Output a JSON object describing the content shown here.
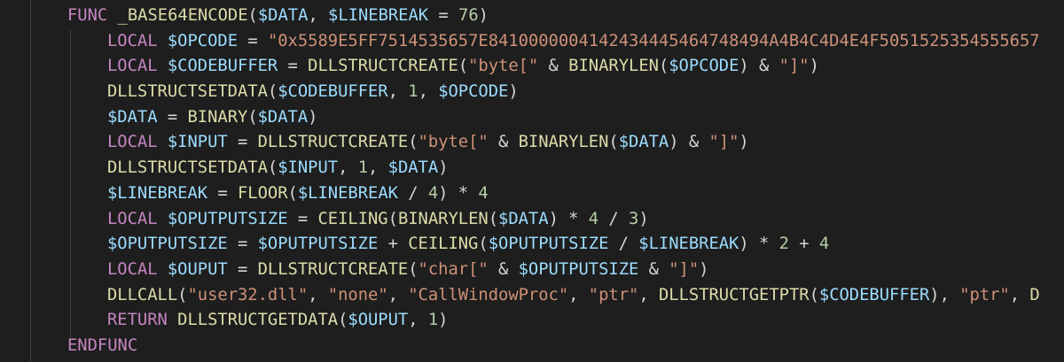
{
  "editor": {
    "colors": {
      "background": "#1e1e1e",
      "keyword": "#c586c0",
      "function": "#dcdcaa",
      "variable": "#9cdcfe",
      "string": "#ce9178",
      "number": "#b5cea8",
      "operator": "#d4d4d4"
    },
    "lines": [
      {
        "indent": 0,
        "tokens": [
          {
            "t": "FUNC",
            "c": "kw"
          },
          {
            "t": " ",
            "c": "op"
          },
          {
            "t": "_BASE64ENCODE",
            "c": "plain"
          },
          {
            "t": "(",
            "c": "op"
          },
          {
            "t": "$DATA",
            "c": "var"
          },
          {
            "t": ", ",
            "c": "op"
          },
          {
            "t": "$LINEBREAK",
            "c": "var"
          },
          {
            "t": " = ",
            "c": "op"
          },
          {
            "t": "76",
            "c": "num"
          },
          {
            "t": ")",
            "c": "op"
          }
        ]
      },
      {
        "indent": 1,
        "tokens": [
          {
            "t": "LOCAL",
            "c": "kw"
          },
          {
            "t": " ",
            "c": "op"
          },
          {
            "t": "$OPCODE",
            "c": "var"
          },
          {
            "t": " = ",
            "c": "op"
          },
          {
            "t": "\"0x5589E5FF7514535657E84100000041424344454647484​94A4B4C4D4E4F5051525354555657",
            "c": "str"
          }
        ]
      },
      {
        "indent": 1,
        "tokens": [
          {
            "t": "LOCAL",
            "c": "kw"
          },
          {
            "t": " ",
            "c": "op"
          },
          {
            "t": "$CODEBUFFER",
            "c": "var"
          },
          {
            "t": " = ",
            "c": "op"
          },
          {
            "t": "DLLSTRUCTCREATE",
            "c": "fn"
          },
          {
            "t": "(",
            "c": "op"
          },
          {
            "t": "\"byte[\"",
            "c": "str"
          },
          {
            "t": " & ",
            "c": "op"
          },
          {
            "t": "BINARYLEN",
            "c": "fn"
          },
          {
            "t": "(",
            "c": "op"
          },
          {
            "t": "$OPCODE",
            "c": "var"
          },
          {
            "t": ") & ",
            "c": "op"
          },
          {
            "t": "\"]\"",
            "c": "str"
          },
          {
            "t": ")",
            "c": "op"
          }
        ]
      },
      {
        "indent": 1,
        "tokens": [
          {
            "t": "DLLSTRUCTSETDATA",
            "c": "fn"
          },
          {
            "t": "(",
            "c": "op"
          },
          {
            "t": "$CODEBUFFER",
            "c": "var"
          },
          {
            "t": ", ",
            "c": "op"
          },
          {
            "t": "1",
            "c": "num"
          },
          {
            "t": ", ",
            "c": "op"
          },
          {
            "t": "$OPCODE",
            "c": "var"
          },
          {
            "t": ")",
            "c": "op"
          }
        ]
      },
      {
        "indent": 1,
        "tokens": [
          {
            "t": "$DATA",
            "c": "var"
          },
          {
            "t": " = ",
            "c": "op"
          },
          {
            "t": "BINARY",
            "c": "fn"
          },
          {
            "t": "(",
            "c": "op"
          },
          {
            "t": "$DATA",
            "c": "var"
          },
          {
            "t": ")",
            "c": "op"
          }
        ]
      },
      {
        "indent": 1,
        "tokens": [
          {
            "t": "LOCAL",
            "c": "kw"
          },
          {
            "t": " ",
            "c": "op"
          },
          {
            "t": "$INPUT",
            "c": "var"
          },
          {
            "t": " = ",
            "c": "op"
          },
          {
            "t": "DLLSTRUCTCREATE",
            "c": "fn"
          },
          {
            "t": "(",
            "c": "op"
          },
          {
            "t": "\"byte[\"",
            "c": "str"
          },
          {
            "t": " & ",
            "c": "op"
          },
          {
            "t": "BINARYLEN",
            "c": "fn"
          },
          {
            "t": "(",
            "c": "op"
          },
          {
            "t": "$DATA",
            "c": "var"
          },
          {
            "t": ") & ",
            "c": "op"
          },
          {
            "t": "\"]\"",
            "c": "str"
          },
          {
            "t": ")",
            "c": "op"
          }
        ]
      },
      {
        "indent": 1,
        "tokens": [
          {
            "t": "DLLSTRUCTSETDATA",
            "c": "fn"
          },
          {
            "t": "(",
            "c": "op"
          },
          {
            "t": "$INPUT",
            "c": "var"
          },
          {
            "t": ", ",
            "c": "op"
          },
          {
            "t": "1",
            "c": "num"
          },
          {
            "t": ", ",
            "c": "op"
          },
          {
            "t": "$DATA",
            "c": "var"
          },
          {
            "t": ")",
            "c": "op"
          }
        ]
      },
      {
        "indent": 1,
        "tokens": [
          {
            "t": "$LINEBREAK",
            "c": "var"
          },
          {
            "t": " = ",
            "c": "op"
          },
          {
            "t": "FLOOR",
            "c": "fn"
          },
          {
            "t": "(",
            "c": "op"
          },
          {
            "t": "$LINEBREAK",
            "c": "var"
          },
          {
            "t": " / ",
            "c": "op"
          },
          {
            "t": "4",
            "c": "num"
          },
          {
            "t": ") * ",
            "c": "op"
          },
          {
            "t": "4",
            "c": "num"
          }
        ]
      },
      {
        "indent": 1,
        "tokens": [
          {
            "t": "LOCAL",
            "c": "kw"
          },
          {
            "t": " ",
            "c": "op"
          },
          {
            "t": "$OPUTPUTSIZE",
            "c": "var"
          },
          {
            "t": " = ",
            "c": "op"
          },
          {
            "t": "CEILING",
            "c": "fn"
          },
          {
            "t": "(",
            "c": "op"
          },
          {
            "t": "BINARYLEN",
            "c": "fn"
          },
          {
            "t": "(",
            "c": "op"
          },
          {
            "t": "$DATA",
            "c": "var"
          },
          {
            "t": ") * ",
            "c": "op"
          },
          {
            "t": "4",
            "c": "num"
          },
          {
            "t": " / ",
            "c": "op"
          },
          {
            "t": "3",
            "c": "num"
          },
          {
            "t": ")",
            "c": "op"
          }
        ]
      },
      {
        "indent": 1,
        "tokens": [
          {
            "t": "$OPUTPUTSIZE",
            "c": "var"
          },
          {
            "t": " = ",
            "c": "op"
          },
          {
            "t": "$OPUTPUTSIZE",
            "c": "var"
          },
          {
            "t": " + ",
            "c": "op"
          },
          {
            "t": "CEILING",
            "c": "fn"
          },
          {
            "t": "(",
            "c": "op"
          },
          {
            "t": "$OPUTPUTSIZE",
            "c": "var"
          },
          {
            "t": " / ",
            "c": "op"
          },
          {
            "t": "$LINEBREAK",
            "c": "var"
          },
          {
            "t": ") * ",
            "c": "op"
          },
          {
            "t": "2",
            "c": "num"
          },
          {
            "t": " + ",
            "c": "op"
          },
          {
            "t": "4",
            "c": "num"
          }
        ]
      },
      {
        "indent": 1,
        "tokens": [
          {
            "t": "LOCAL",
            "c": "kw"
          },
          {
            "t": " ",
            "c": "op"
          },
          {
            "t": "$OUPUT",
            "c": "var"
          },
          {
            "t": " = ",
            "c": "op"
          },
          {
            "t": "DLLSTRUCTCREATE",
            "c": "fn"
          },
          {
            "t": "(",
            "c": "op"
          },
          {
            "t": "\"char[\"",
            "c": "str"
          },
          {
            "t": " & ",
            "c": "op"
          },
          {
            "t": "$OPUTPUTSIZE",
            "c": "var"
          },
          {
            "t": " & ",
            "c": "op"
          },
          {
            "t": "\"]\"",
            "c": "str"
          },
          {
            "t": ")",
            "c": "op"
          }
        ]
      },
      {
        "indent": 1,
        "tokens": [
          {
            "t": "DLLCALL",
            "c": "fn"
          },
          {
            "t": "(",
            "c": "op"
          },
          {
            "t": "\"user32.dll\"",
            "c": "str"
          },
          {
            "t": ", ",
            "c": "op"
          },
          {
            "t": "\"none\"",
            "c": "str"
          },
          {
            "t": ", ",
            "c": "op"
          },
          {
            "t": "\"CallWindowProc\"",
            "c": "str"
          },
          {
            "t": ", ",
            "c": "op"
          },
          {
            "t": "\"ptr\"",
            "c": "str"
          },
          {
            "t": ", ",
            "c": "op"
          },
          {
            "t": "DLLSTRUCTGETPTR",
            "c": "fn"
          },
          {
            "t": "(",
            "c": "op"
          },
          {
            "t": "$CODEBUFFER",
            "c": "var"
          },
          {
            "t": "), ",
            "c": "op"
          },
          {
            "t": "\"ptr\"",
            "c": "str"
          },
          {
            "t": ", ",
            "c": "op"
          },
          {
            "t": "D",
            "c": "fn"
          }
        ]
      },
      {
        "indent": 1,
        "tokens": [
          {
            "t": "RETURN",
            "c": "kw"
          },
          {
            "t": " ",
            "c": "op"
          },
          {
            "t": "DLLSTRUCTGETDATA",
            "c": "fn"
          },
          {
            "t": "(",
            "c": "op"
          },
          {
            "t": "$OUPUT",
            "c": "var"
          },
          {
            "t": ", ",
            "c": "op"
          },
          {
            "t": "1",
            "c": "num"
          },
          {
            "t": ")",
            "c": "op"
          }
        ]
      },
      {
        "indent": 0,
        "tokens": [
          {
            "t": "ENDFUNC",
            "c": "kw"
          }
        ]
      }
    ]
  }
}
